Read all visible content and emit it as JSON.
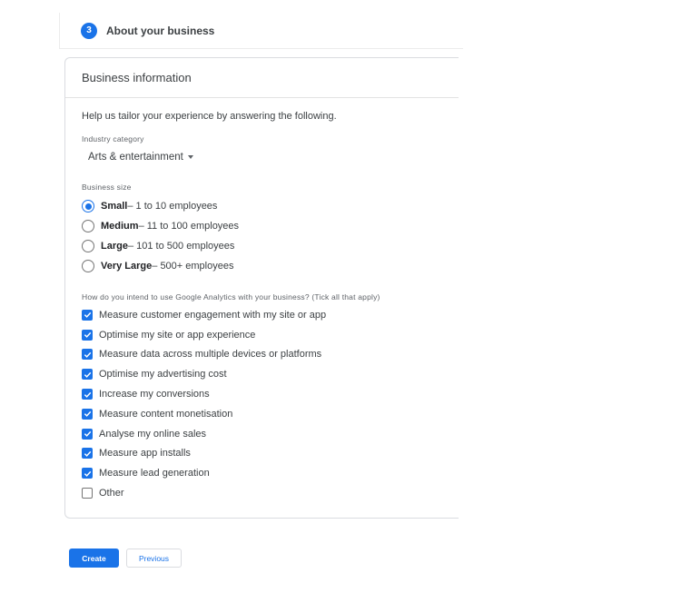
{
  "step": {
    "number": "3",
    "title": "About your business"
  },
  "card": {
    "title": "Business information",
    "intro": "Help us tailor your experience by answering the following.",
    "industry": {
      "label": "Industry category",
      "selected": "Arts & entertainment"
    },
    "business_size": {
      "label": "Business size",
      "options": [
        {
          "name": "Small",
          "detail": " – 1 to 10 employees",
          "selected": true
        },
        {
          "name": "Medium",
          "detail": " – 11 to 100 employees",
          "selected": false
        },
        {
          "name": "Large",
          "detail": " – 101 to 500 employees",
          "selected": false
        },
        {
          "name": "Very Large",
          "detail": " – 500+ employees",
          "selected": false
        }
      ]
    },
    "intent": {
      "label": "How do you intend to use Google Analytics with your business? (Tick all that apply)",
      "options": [
        {
          "label": "Measure customer engagement with my site or app",
          "checked": true
        },
        {
          "label": "Optimise my site or app experience",
          "checked": true
        },
        {
          "label": "Measure data across multiple devices or platforms",
          "checked": true
        },
        {
          "label": "Optimise my advertising cost",
          "checked": true
        },
        {
          "label": "Increase my conversions",
          "checked": true
        },
        {
          "label": "Measure content monetisation",
          "checked": true
        },
        {
          "label": "Analyse my online sales",
          "checked": true
        },
        {
          "label": "Measure app installs",
          "checked": true
        },
        {
          "label": "Measure lead generation",
          "checked": true
        },
        {
          "label": "Other",
          "checked": false
        }
      ]
    }
  },
  "buttons": {
    "create": "Create",
    "previous": "Previous"
  },
  "colors": {
    "accent": "#1a73e8"
  }
}
